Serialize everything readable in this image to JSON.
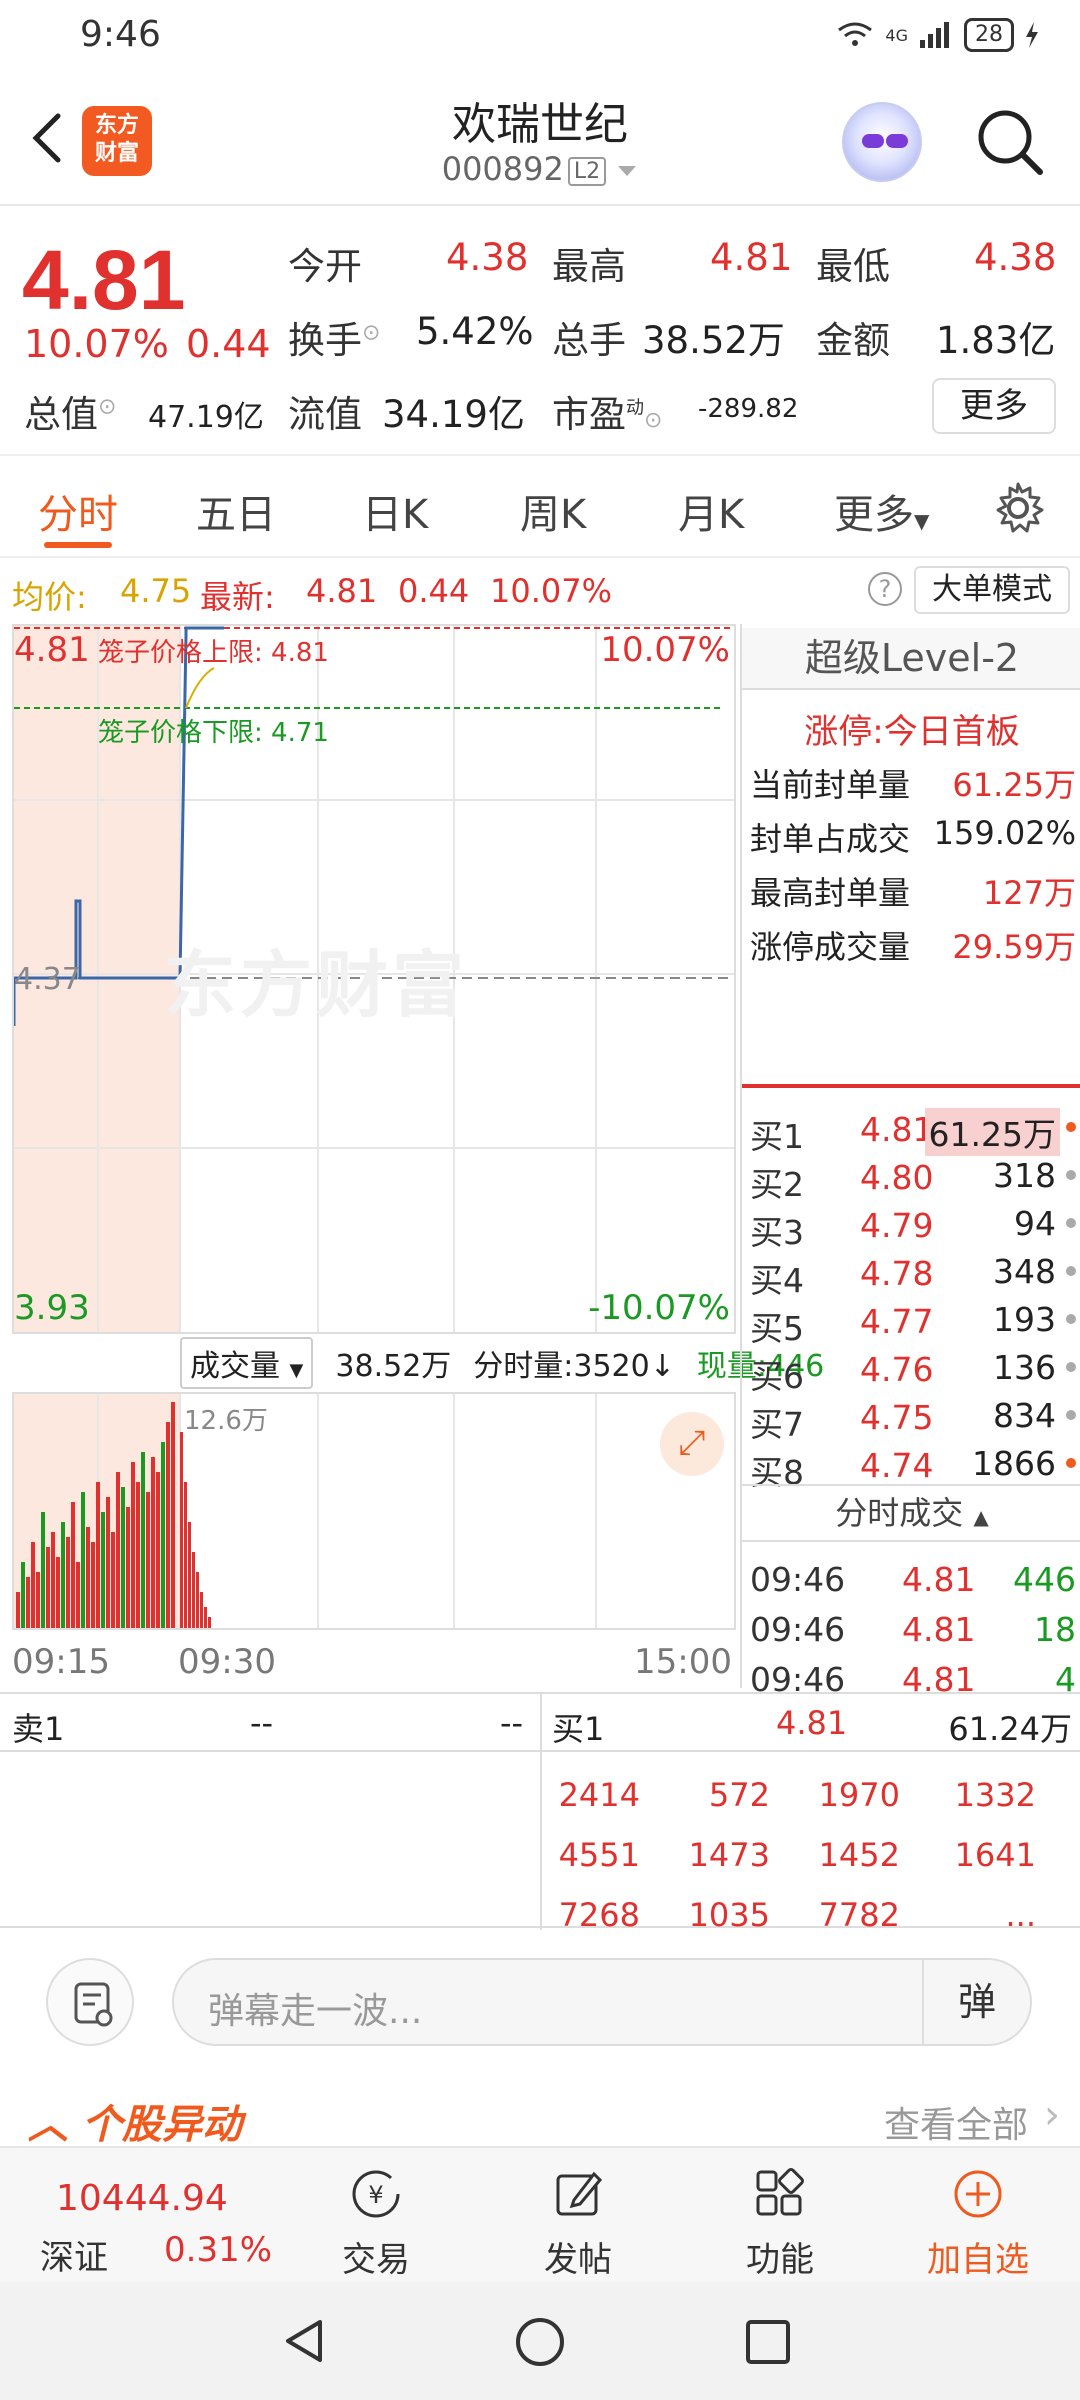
{
  "status_bar": {
    "time": "9:46",
    "network": "4G",
    "battery": "28"
  },
  "header": {
    "logo_line1": "东方",
    "logo_line2": "财富",
    "stock_name": "欢瑞世纪",
    "stock_code": "000892",
    "level_badge": "L2"
  },
  "quote": {
    "price": "4.81",
    "change_pct": "10.07%",
    "change": "0.44",
    "open_label": "今开",
    "open": "4.38",
    "high_label": "最高",
    "high": "4.81",
    "low_label": "最低",
    "low": "4.38",
    "turnover_label": "换手",
    "turnover": "5.42%",
    "volume_label": "总手",
    "volume": "38.52万",
    "amount_label": "金额",
    "amount": "1.83亿",
    "mktcap_label": "总值",
    "mktcap": "47.19亿",
    "float_label": "流值",
    "float": "34.19亿",
    "pe_label": "市盈",
    "pe_sup": "动",
    "pe": "-289.82",
    "more_button": "更多"
  },
  "tabs": [
    "分时",
    "五日",
    "日K",
    "周K",
    "月K",
    "更多"
  ],
  "info_bar": {
    "avg_label": "均价:",
    "avg": "4.75",
    "latest_label": "最新:",
    "latest": "4.81",
    "latest_chg": "0.44",
    "latest_pct": "10.07%",
    "help": "?",
    "big_order_mode": "大单模式"
  },
  "chart": {
    "top_price": "4.81",
    "top_pct": "10.07%",
    "mid_price": "4.37",
    "bottom_price": "3.93",
    "bottom_pct": "-10.07%",
    "cage_upper": "笼子价格上限:  4.81",
    "cage_lower": "笼子价格下限:  4.71",
    "watermark": "东方财富"
  },
  "volume": {
    "selector": "成交量",
    "total": "38.52万",
    "minute_vol": "分时量:3520↓",
    "current": "现量:446",
    "max_label": "12.6万",
    "time_start": "09:15",
    "time_mid": "09:30",
    "time_end": "15:00"
  },
  "level2": {
    "title": "超级Level-2",
    "limit_up": "涨停:今日首板",
    "rows": [
      {
        "label": "当前封单量",
        "value": "61.25万"
      },
      {
        "label": "封单占成交",
        "value": "159.02%"
      },
      {
        "label": "最高封单量",
        "value": "127万"
      },
      {
        "label": "涨停成交量",
        "value": "29.59万"
      }
    ],
    "bids": [
      {
        "label": "买1",
        "price": "4.81",
        "vol": "61.25万"
      },
      {
        "label": "买2",
        "price": "4.80",
        "vol": "318"
      },
      {
        "label": "买3",
        "price": "4.79",
        "vol": "94"
      },
      {
        "label": "买4",
        "price": "4.78",
        "vol": "348"
      },
      {
        "label": "买5",
        "price": "4.77",
        "vol": "193"
      },
      {
        "label": "买6",
        "price": "4.76",
        "vol": "136"
      },
      {
        "label": "买7",
        "price": "4.75",
        "vol": "834"
      },
      {
        "label": "买8",
        "price": "4.74",
        "vol": "1866"
      }
    ],
    "ticks_title": "分时成交",
    "ticks": [
      {
        "time": "09:46",
        "price": "4.81",
        "vol": "446"
      },
      {
        "time": "09:46",
        "price": "4.81",
        "vol": "18"
      },
      {
        "time": "09:46",
        "price": "4.81",
        "vol": "4"
      }
    ]
  },
  "depth": {
    "sell_label": "卖1",
    "sell_price": "--",
    "sell_vol": "--",
    "buy_label": "买1",
    "buy_price": "4.81",
    "buy_vol": "61.24万",
    "queue": [
      [
        "2414",
        "572",
        "1970",
        "1332"
      ],
      [
        "4551",
        "1473",
        "1452",
        "1641"
      ],
      [
        "7268",
        "1035",
        "7782",
        "..."
      ]
    ]
  },
  "danmu": {
    "placeholder": "弹幕走一波...",
    "send": "弹"
  },
  "yidong": {
    "title": "个股异动",
    "view_all": "查看全部"
  },
  "bottom_bar": {
    "index_value": "10444.94",
    "index_name": "深证",
    "index_pct": "0.31%",
    "trade": "交易",
    "post": "发帖",
    "function": "功能",
    "add_watch": "加自选"
  },
  "colors": {
    "up": "#e0312f",
    "down": "#1a9a22",
    "accent": "#ef5a1e"
  }
}
